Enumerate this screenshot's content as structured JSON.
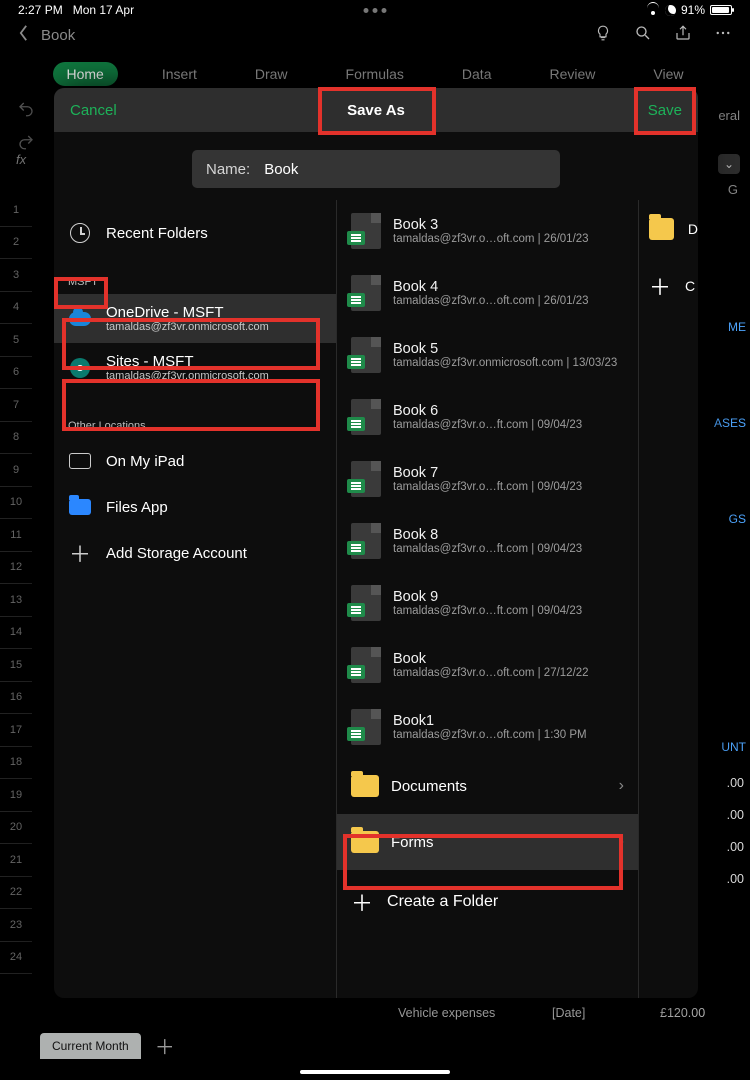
{
  "status": {
    "time": "2:27 PM",
    "date": "Mon 17 Apr",
    "battery_pct": "91%"
  },
  "app": {
    "doc_title": "Book",
    "general_label": "eral"
  },
  "ribbon": {
    "tabs": [
      "Home",
      "Insert",
      "Draw",
      "Formulas",
      "Data",
      "Review",
      "View"
    ],
    "active": 0
  },
  "modal": {
    "cancel": "Cancel",
    "title": "Save As",
    "save": "Save",
    "name_label": "Name:",
    "name_value": "Book",
    "recent": "Recent Folders",
    "section": "MSFT",
    "onedrive": {
      "title": "OneDrive - MSFT",
      "sub": "tamaldas@zf3vr.onmicrosoft.com"
    },
    "sites": {
      "title": "Sites - MSFT",
      "sub": "tamaldas@zf3vr.onmicrosoft.com"
    },
    "other_label": "Other Locations",
    "on_ipad": "On My iPad",
    "files_app": "Files App",
    "add_storage": "Add Storage Account",
    "files": [
      {
        "name": "Book 3",
        "meta": "tamaldas@zf3vr.o…oft.com | 26/01/23"
      },
      {
        "name": "Book 4",
        "meta": "tamaldas@zf3vr.o…oft.com | 26/01/23"
      },
      {
        "name": "Book 5",
        "meta": "tamaldas@zf3vr.onmicrosoft.com | 13/03/23"
      },
      {
        "name": "Book 6",
        "meta": "tamaldas@zf3vr.o…ft.com | 09/04/23"
      },
      {
        "name": "Book 7",
        "meta": "tamaldas@zf3vr.o…ft.com | 09/04/23"
      },
      {
        "name": "Book 8",
        "meta": "tamaldas@zf3vr.o…ft.com | 09/04/23"
      },
      {
        "name": "Book 9",
        "meta": "tamaldas@zf3vr.o…ft.com | 09/04/23"
      },
      {
        "name": "Book",
        "meta": "tamaldas@zf3vr.o…oft.com | 27/12/22"
      },
      {
        "name": "Book1",
        "meta": "tamaldas@zf3vr.o…oft.com | 1:30 PM"
      }
    ],
    "folders": [
      {
        "name": "Documents",
        "selected": false
      },
      {
        "name": "Forms",
        "selected": true
      }
    ],
    "create_folder": "Create a Folder",
    "right_strip": {
      "d_label": "D",
      "c_label": "C"
    }
  },
  "sheet": {
    "row_numbers": [
      "1",
      "2",
      "3",
      "4",
      "5",
      "6",
      "7",
      "8",
      "9",
      "10",
      "11",
      "12",
      "13",
      "14",
      "15",
      "16",
      "17",
      "18",
      "19",
      "20",
      "21",
      "22",
      "23",
      "24"
    ],
    "col_hint": "G",
    "bg_hints": {
      "me": "ME",
      "ases": "ASES",
      "gs": "GS",
      "unt": "UNT",
      "a1": ".00",
      "a2": ".00",
      "a3": ".00",
      "a4": ".00"
    },
    "footer_item": "Vehicle expenses",
    "footer_date": "[Date]",
    "footer_amt": "£120.00",
    "tab": "Current Month"
  }
}
